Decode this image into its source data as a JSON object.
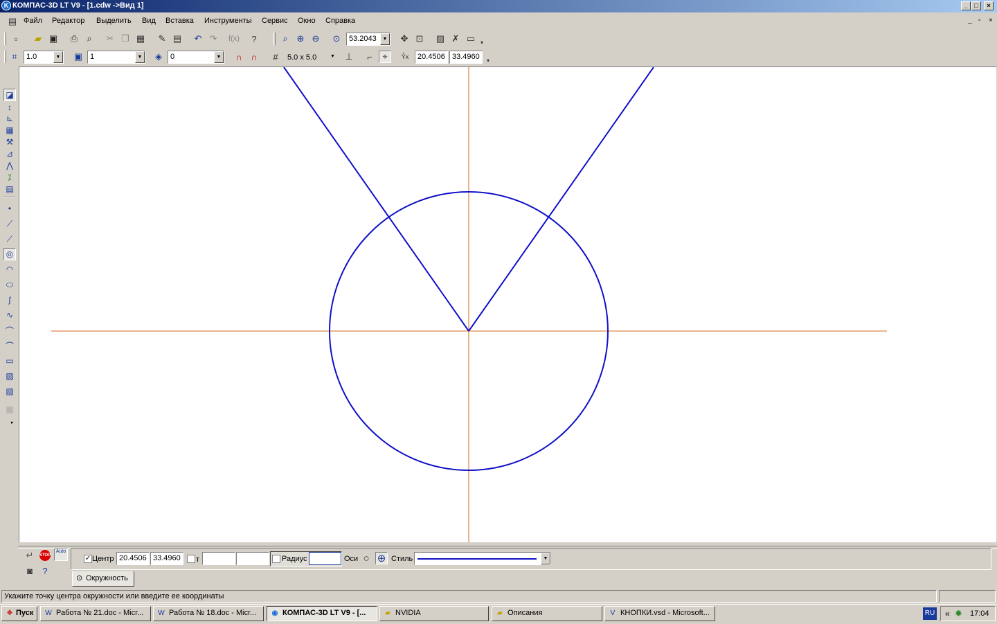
{
  "window": {
    "title": "КОМПАС-3D LT V9 - [1.cdw ->Вид 1]",
    "buttons": {
      "minimize": "_",
      "maximize": "□",
      "close": "×"
    }
  },
  "menu": {
    "items": [
      "Файл",
      "Редактор",
      "Выделить",
      "Вид",
      "Вставка",
      "Инструменты",
      "Сервис",
      "Окно",
      "Справка"
    ],
    "mdi_buttons": {
      "minimize": "_",
      "restore": "▫",
      "close": "×"
    }
  },
  "toolbar_standard": {
    "zoom_value": "53.2043"
  },
  "toolbar_current_state": {
    "line_step": "1.0",
    "layer": "1",
    "view": "0",
    "grid_step": "5.0 x 5.0",
    "coord_x": "20.4506",
    "coord_y": "33.4960"
  },
  "drawing": {
    "axis_color": "#d2691e",
    "geometry_color": "#1010c8"
  },
  "properties_panel": {
    "center_label": "Центр",
    "center_x": "20.4506",
    "center_y": "33.4960",
    "t_label": "т",
    "t_x": "",
    "t_y": "",
    "radius_label": "Радиус",
    "radius_value": "",
    "axes_label": "Оси",
    "style_label": "Стиль",
    "tab_label": "Окружность",
    "auto_label": "Auto",
    "stop_label": "STOP"
  },
  "status": {
    "hint": "Укажите точку центра окружности или введите ее координаты"
  },
  "taskbar": {
    "start_label": "Пуск",
    "tasks": [
      {
        "label": "Работа № 21.doc - Micr...",
        "icon": "word-icon"
      },
      {
        "label": "Работа № 18.doc - Micr...",
        "icon": "word-icon"
      },
      {
        "label": "КОМПАС-3D LT V9 - [...",
        "icon": "kompas-icon",
        "active": true
      },
      {
        "label": "NVIDIA",
        "icon": "folder-icon"
      },
      {
        "label": "Описания",
        "icon": "folder-icon"
      },
      {
        "label": "КНОПКИ.vsd - Microsoft...",
        "icon": "visio-icon"
      }
    ],
    "tray": {
      "language": "RU",
      "arrows": "«",
      "clock": "17:04"
    }
  }
}
